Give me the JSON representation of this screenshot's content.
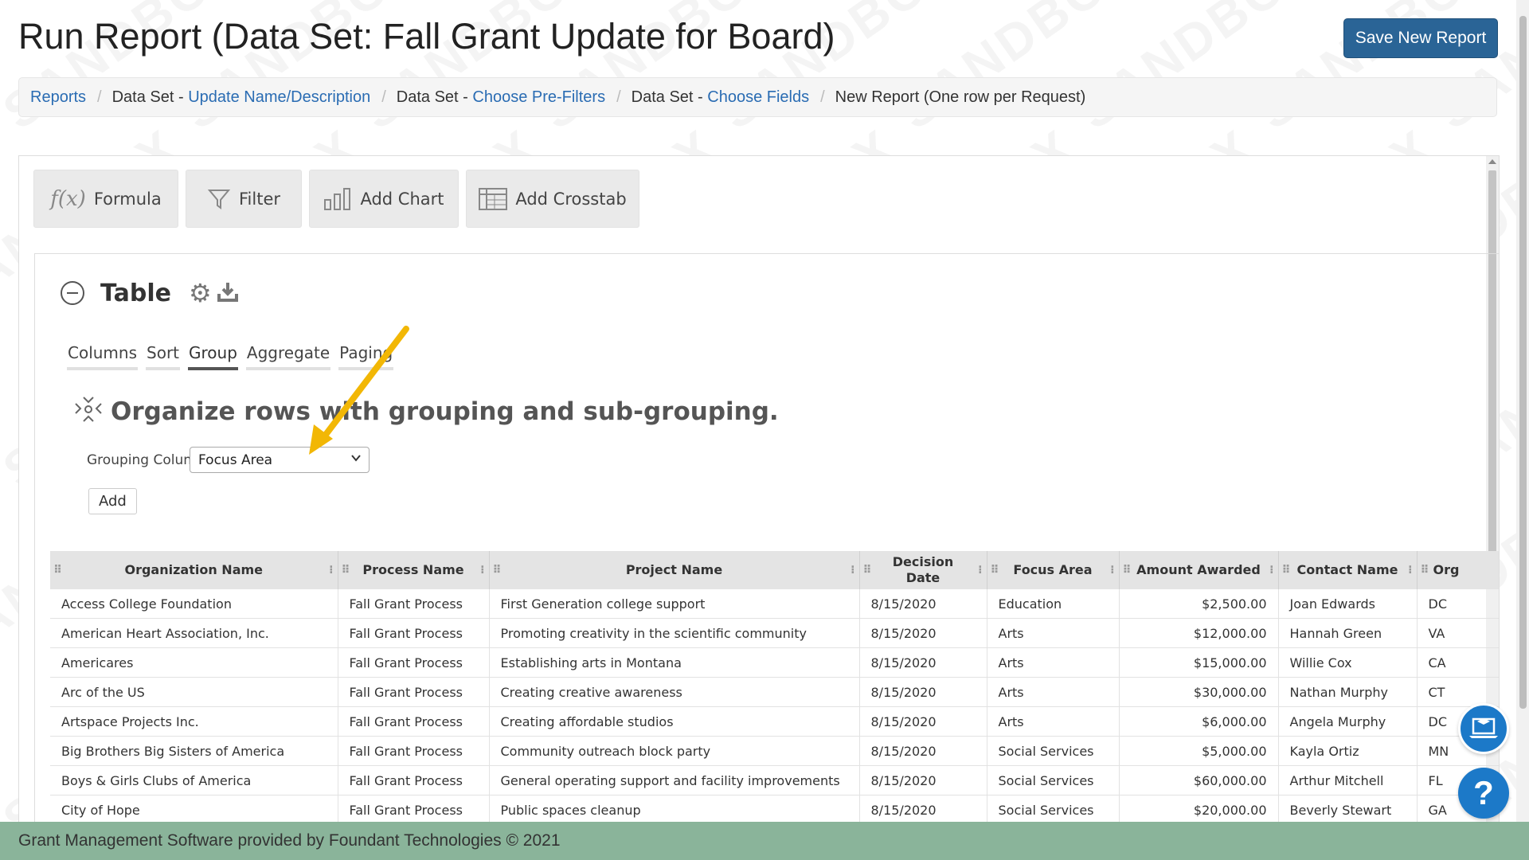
{
  "header": {
    "title": "Run Report (Data Set: Fall Grant Update for Board)",
    "save_button": "Save New Report"
  },
  "breadcrumb": [
    {
      "prefix": "",
      "label": "Reports",
      "link": true
    },
    {
      "prefix": "Data Set - ",
      "label": "Update Name/Description",
      "link": true
    },
    {
      "prefix": "Data Set - ",
      "label": "Choose Pre-Filters",
      "link": true
    },
    {
      "prefix": "Data Set - ",
      "label": "Choose Fields",
      "link": true
    },
    {
      "prefix": "",
      "label": "New Report (One row per Request)",
      "link": false
    }
  ],
  "watermark": "SANDBOX",
  "toolbar": {
    "formula": "Formula",
    "formula_icon": "f(x)",
    "filter": "Filter",
    "add_chart": "Add Chart",
    "add_crosstab": "Add Crosstab"
  },
  "widget": {
    "title": "Table",
    "tabs": [
      "Columns",
      "Sort",
      "Group",
      "Aggregate",
      "Paging"
    ],
    "active_tab": "Group",
    "group_heading": "Organize rows with grouping and sub-grouping.",
    "grouping_label": "Grouping Column",
    "grouping_value": "Focus Area",
    "add_button": "Add"
  },
  "table": {
    "columns": [
      "Organization Name",
      "Process Name",
      "Project Name",
      "Decision Date",
      "Focus Area",
      "Amount Awarded",
      "Contact Name",
      "Org"
    ],
    "rows": [
      [
        "Access College Foundation",
        "Fall Grant Process",
        "First Generation college support",
        "8/15/2020",
        "Education",
        "$2,500.00",
        "Joan Edwards",
        "DC"
      ],
      [
        "American Heart Association, Inc.",
        "Fall Grant Process",
        "Promoting creativity in the scientific community",
        "8/15/2020",
        "Arts",
        "$12,000.00",
        "Hannah Green",
        "VA"
      ],
      [
        "Americares",
        "Fall Grant Process",
        "Establishing arts in Montana",
        "8/15/2020",
        "Arts",
        "$15,000.00",
        "Willie Cox",
        "CA"
      ],
      [
        "Arc of the US",
        "Fall Grant Process",
        "Creating creative awareness",
        "8/15/2020",
        "Arts",
        "$30,000.00",
        "Nathan Murphy",
        "CT"
      ],
      [
        "Artspace Projects Inc.",
        "Fall Grant Process",
        "Creating affordable studios",
        "8/15/2020",
        "Arts",
        "$6,000.00",
        "Angela Murphy",
        "DC"
      ],
      [
        "Big Brothers Big Sisters of America",
        "Fall Grant Process",
        "Community outreach block party",
        "8/15/2020",
        "Social Services",
        "$5,000.00",
        "Kayla Ortiz",
        "MN"
      ],
      [
        "Boys & Girls Clubs of America",
        "Fall Grant Process",
        "General operating support and facility improvements",
        "8/15/2020",
        "Social Services",
        "$60,000.00",
        "Arthur Mitchell",
        "FL"
      ],
      [
        "City of Hope",
        "Fall Grant Process",
        "Public spaces cleanup",
        "8/15/2020",
        "Social Services",
        "$20,000.00",
        "Beverly Stewart",
        "GA"
      ]
    ]
  },
  "footer": "Grant Management Software provided by Foundant Technologies © 2021",
  "colors": {
    "save_button": "#2a6496",
    "link": "#2a6cb3",
    "footer": "#8ab49a",
    "fab": "#1c79c8",
    "arrow": "#f2b705"
  }
}
